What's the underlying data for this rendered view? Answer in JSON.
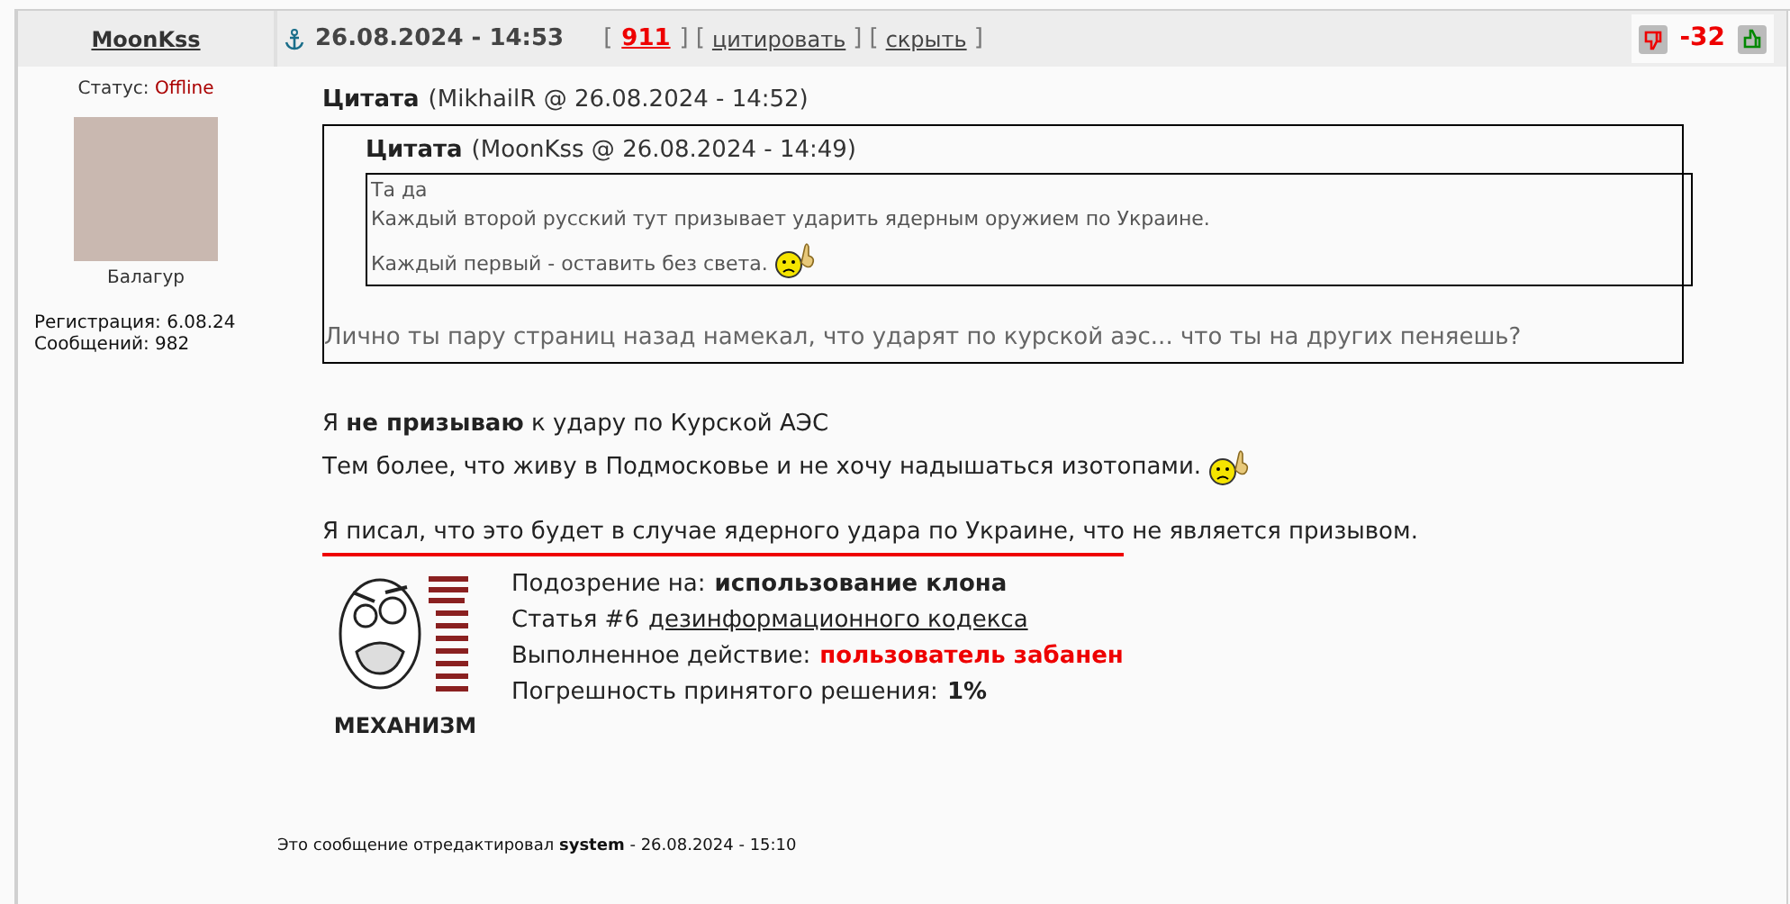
{
  "author": {
    "name": "MoonKss",
    "status_label": "Статус:",
    "status": "Offline",
    "rank": "Балагур",
    "registration": "Регистрация: 6.08.24",
    "posts": "Сообщений: 982"
  },
  "post_header": {
    "date": "26.08.2024 - 14:53",
    "links": [
      {
        "kind": "number",
        "open": "[",
        "label": "911",
        "close": "]"
      },
      {
        "kind": "action",
        "open": "[",
        "label": "цитировать",
        "close": "]"
      },
      {
        "kind": "action",
        "open": "[",
        "label": "скрыть",
        "close": "]"
      }
    ],
    "rating": "-32"
  },
  "quote": {
    "title": "Цитата",
    "meta": "(MikhailR @ 26.08.2024 - 14:52)",
    "inner": {
      "title": "Цитата",
      "meta": "(MoonKss @ 26.08.2024 - 14:49)",
      "lines": [
        "Та да",
        "Каждый второй русский тут призывает ударить ядерным оружием по Украине.",
        "Каждый первый - оставить без света."
      ]
    },
    "reply": "Лично ты пару страниц назад намекал, что ударят по курской аэс... что ты на других пеняешь?"
  },
  "body": [
    "Я **не призываю** к удару по Курской АЭС",
    "Тем более, что живу в Подмосковье и не хочу надышаться изотопами.",
    "Я писал, что это будет в случае ядерного удара по Украине, что не является призывом."
  ],
  "ban": {
    "caption": "МЕХАНИЗМ",
    "rows": [
      {
        "label": "Подозрение на:",
        "value": "использование клона",
        "kind": "bold"
      },
      {
        "label": "Статья #6",
        "value": "дезинформационного кодекса",
        "kind": "link"
      },
      {
        "label": "Выполненное действие:",
        "value": "пользователь забанен",
        "kind": "alert"
      },
      {
        "label": "Погрешность принятого решения:",
        "value": "1%",
        "kind": "bold"
      }
    ]
  },
  "edit_note": "Это сообщение отредактировал **system** - 26.08.2024 - 15:10"
}
